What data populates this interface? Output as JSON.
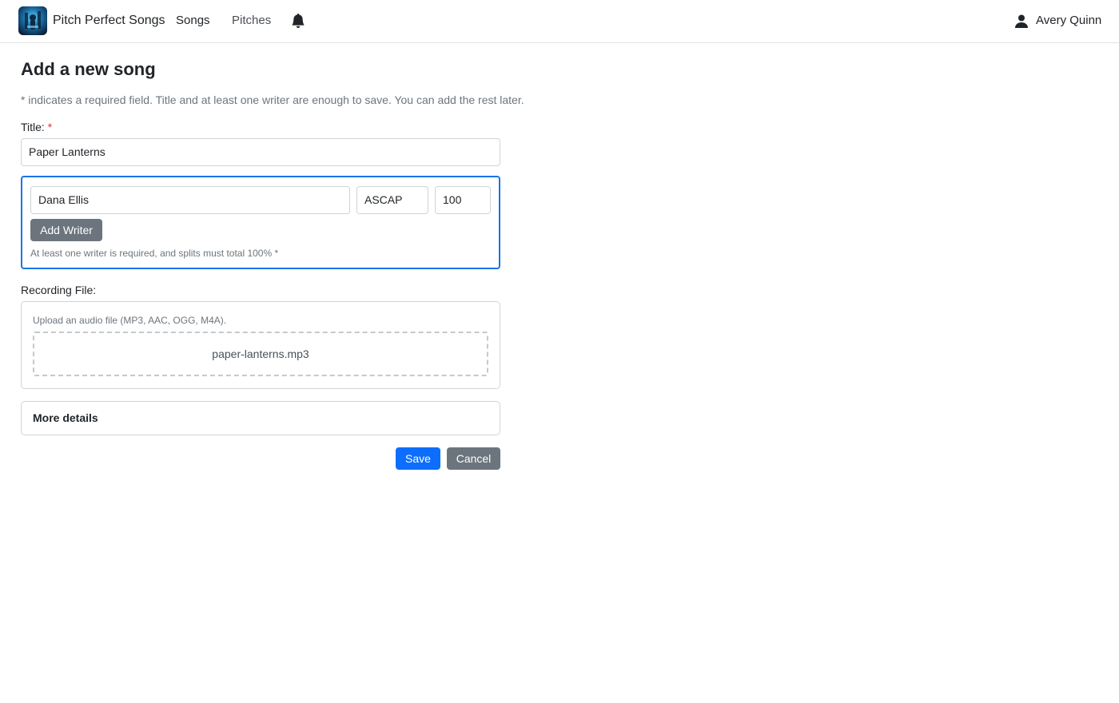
{
  "navbar": {
    "brand": "Pitch Perfect Songs",
    "links": [
      {
        "label": "Songs"
      },
      {
        "label": "Pitches"
      }
    ],
    "user_name": "Avery Quinn"
  },
  "page": {
    "title": "Add a new song",
    "hint": "* indicates a required field. Title and at least one writer are enough to save. You can add the rest later."
  },
  "form": {
    "title_label": "Title:",
    "required_marker": "*",
    "title_value": "Paper Lanterns",
    "writers": [
      {
        "name": "Dana Ellis",
        "pro": "ASCAP",
        "split": "100"
      }
    ],
    "add_writer_label": "Add Writer",
    "writers_help": "At least one writer is required, and splits must total 100% *",
    "recording_label": "Recording File:",
    "upload_hint": "Upload an audio file (MP3, AAC, OGG, M4A).",
    "uploaded_file": "paper-lanterns.mp3",
    "more_details_label": "More details",
    "save_label": "Save",
    "cancel_label": "Cancel"
  },
  "colors": {
    "primary": "#0d6efd",
    "secondary": "#6c757d",
    "focus_border": "#1a73e8",
    "required": "#dc3545"
  },
  "icons": [
    "app-logo-icon",
    "bell-icon",
    "user-icon"
  ]
}
